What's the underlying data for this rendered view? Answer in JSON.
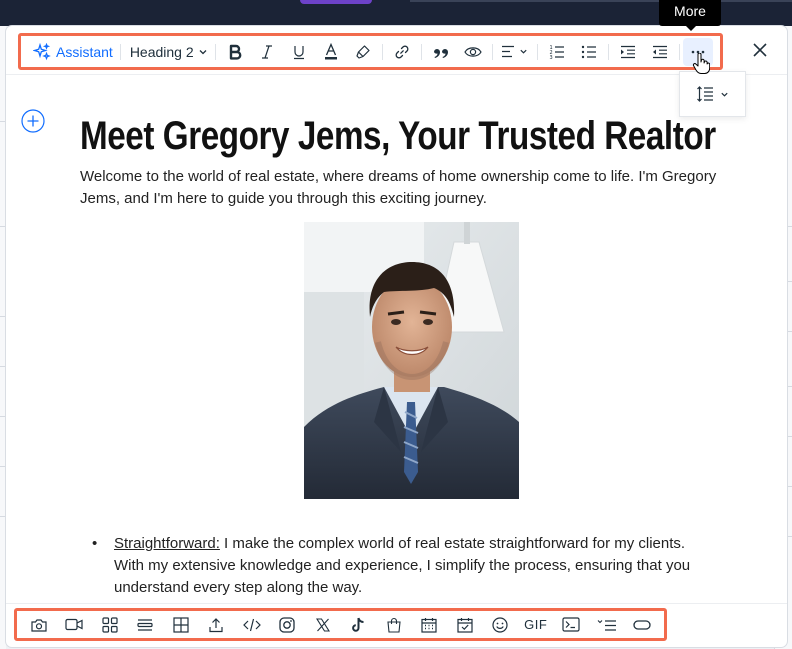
{
  "toolbar": {
    "assistant_label": "Assistant",
    "heading_label": "Heading 2",
    "more_tooltip": "More"
  },
  "icons": {
    "top": [
      "sparkle-icon",
      "chevron-down-icon",
      "bold-icon",
      "italic-icon",
      "underline-icon",
      "text-color-icon",
      "highlight-icon",
      "link-icon",
      "quote-icon",
      "spoiler-eye-icon",
      "align-left-icon",
      "numbered-list-icon",
      "bulleted-list-icon",
      "indent-icon",
      "outdent-icon",
      "more-dots-icon",
      "close-icon",
      "line-spacing-icon"
    ],
    "bottom": [
      "camera-icon",
      "video-icon",
      "gallery-icon",
      "divider-icon",
      "table-icon",
      "upload-icon",
      "code-icon",
      "instagram-icon",
      "x-icon",
      "tiktok-icon",
      "shopping-bag-icon",
      "calendar-icon",
      "event-icon",
      "emoji-icon",
      "gif-icon",
      "code-block-icon",
      "collapsible-list-icon",
      "button-icon"
    ]
  },
  "content": {
    "title": "Meet Gregory Jems, Your Trusted Realtor",
    "intro": "Welcome to the world of real estate, where dreams of home ownership come to life. I'm Gregory Jems, and I'm here to guide you through this exciting journey.",
    "bullet_label": "Straightforward:",
    "bullet_text": " I make the complex world of real estate straightforward for my clients. With my extensive knowledge and experience, I simplify the process, ensuring that you understand every step along the way."
  },
  "bottom_toolbar": {
    "gif_label": "GIF"
  },
  "colors": {
    "accent": "#116dff",
    "highlight_border": "#f26b4d",
    "text": "#20303c"
  }
}
